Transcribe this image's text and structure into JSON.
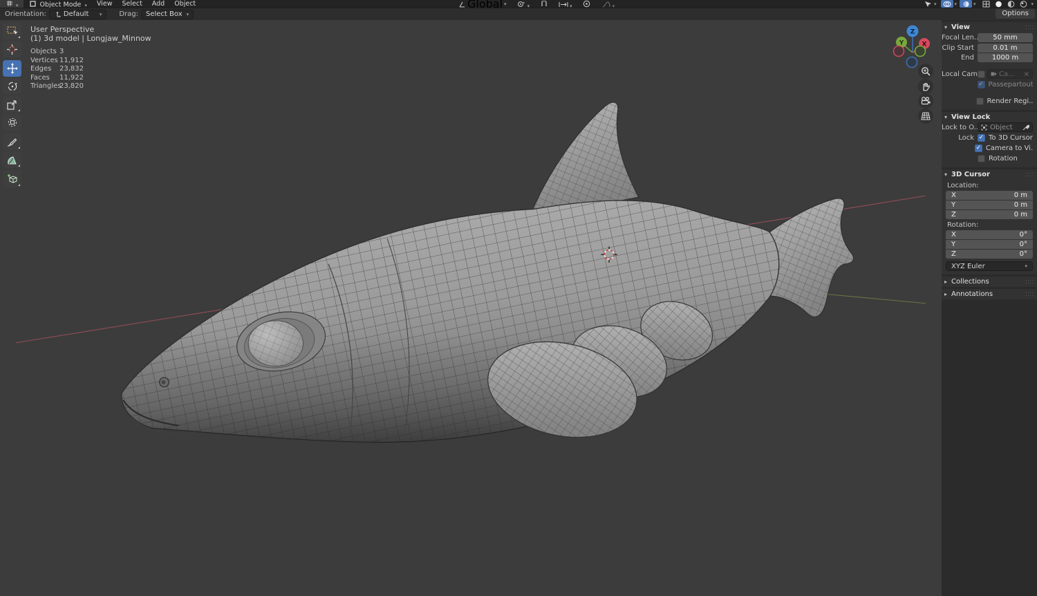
{
  "colors": {
    "accent_blue": "#4772b3",
    "viewport_bg": "#3c3c3c",
    "axis_x_red": "#a5505e",
    "axis_y_green": "#6d7d43",
    "body_gray": "#9a9a9a"
  },
  "menubar": {
    "mode_label": "Object Mode",
    "menus": [
      "View",
      "Select",
      "Add",
      "Object"
    ],
    "orientation_value": "Global"
  },
  "toolsettings": {
    "orientation_label": "Orientation:",
    "orientation_value": "Default",
    "drag_label": "Drag:",
    "drag_value": "Select Box",
    "options_label": "Options"
  },
  "viewport": {
    "perspective": "User Perspective",
    "model_info": "(1) 3d model | Longjaw_Minnow",
    "stats": [
      {
        "label": "Objects",
        "value": "3"
      },
      {
        "label": "Vertices",
        "value": "11,912"
      },
      {
        "label": "Edges",
        "value": "23,832"
      },
      {
        "label": "Faces",
        "value": "11,922"
      },
      {
        "label": "Triangles",
        "value": "23,820"
      }
    ],
    "gizmo_axes": {
      "x": "X",
      "y": "Y",
      "z": "Z"
    }
  },
  "sidebar": {
    "view": {
      "title": "View",
      "focal_label": "Focal Len...",
      "focal_value": "50 mm",
      "clip_start_label": "Clip Start",
      "clip_start_value": "0.01 m",
      "clip_end_label": "End",
      "clip_end_value": "1000 m",
      "local_camera_label": "Local Cam...",
      "local_camera_value": "Ca...",
      "passepartout_label": "Passepartout",
      "render_region_label": "Render Regi..."
    },
    "view_lock": {
      "title": "View Lock",
      "lock_object_label": "Lock to O...",
      "lock_object_placeholder": "Object",
      "lock_label": "Lock",
      "to_3d_cursor": "To 3D Cursor",
      "camera_to_view": "Camera to Vi...",
      "rotation": "Rotation"
    },
    "cursor3d": {
      "title": "3D Cursor",
      "location_label": "Location:",
      "loc": [
        {
          "axis": "X",
          "value": "0 m"
        },
        {
          "axis": "Y",
          "value": "0 m"
        },
        {
          "axis": "Z",
          "value": "0 m"
        }
      ],
      "rotation_label": "Rotation:",
      "rot": [
        {
          "axis": "X",
          "value": "0°"
        },
        {
          "axis": "Y",
          "value": "0°"
        },
        {
          "axis": "Z",
          "value": "0°"
        }
      ],
      "euler": "XYZ Euler"
    },
    "collections_title": "Collections",
    "annotations_title": "Annotations"
  }
}
